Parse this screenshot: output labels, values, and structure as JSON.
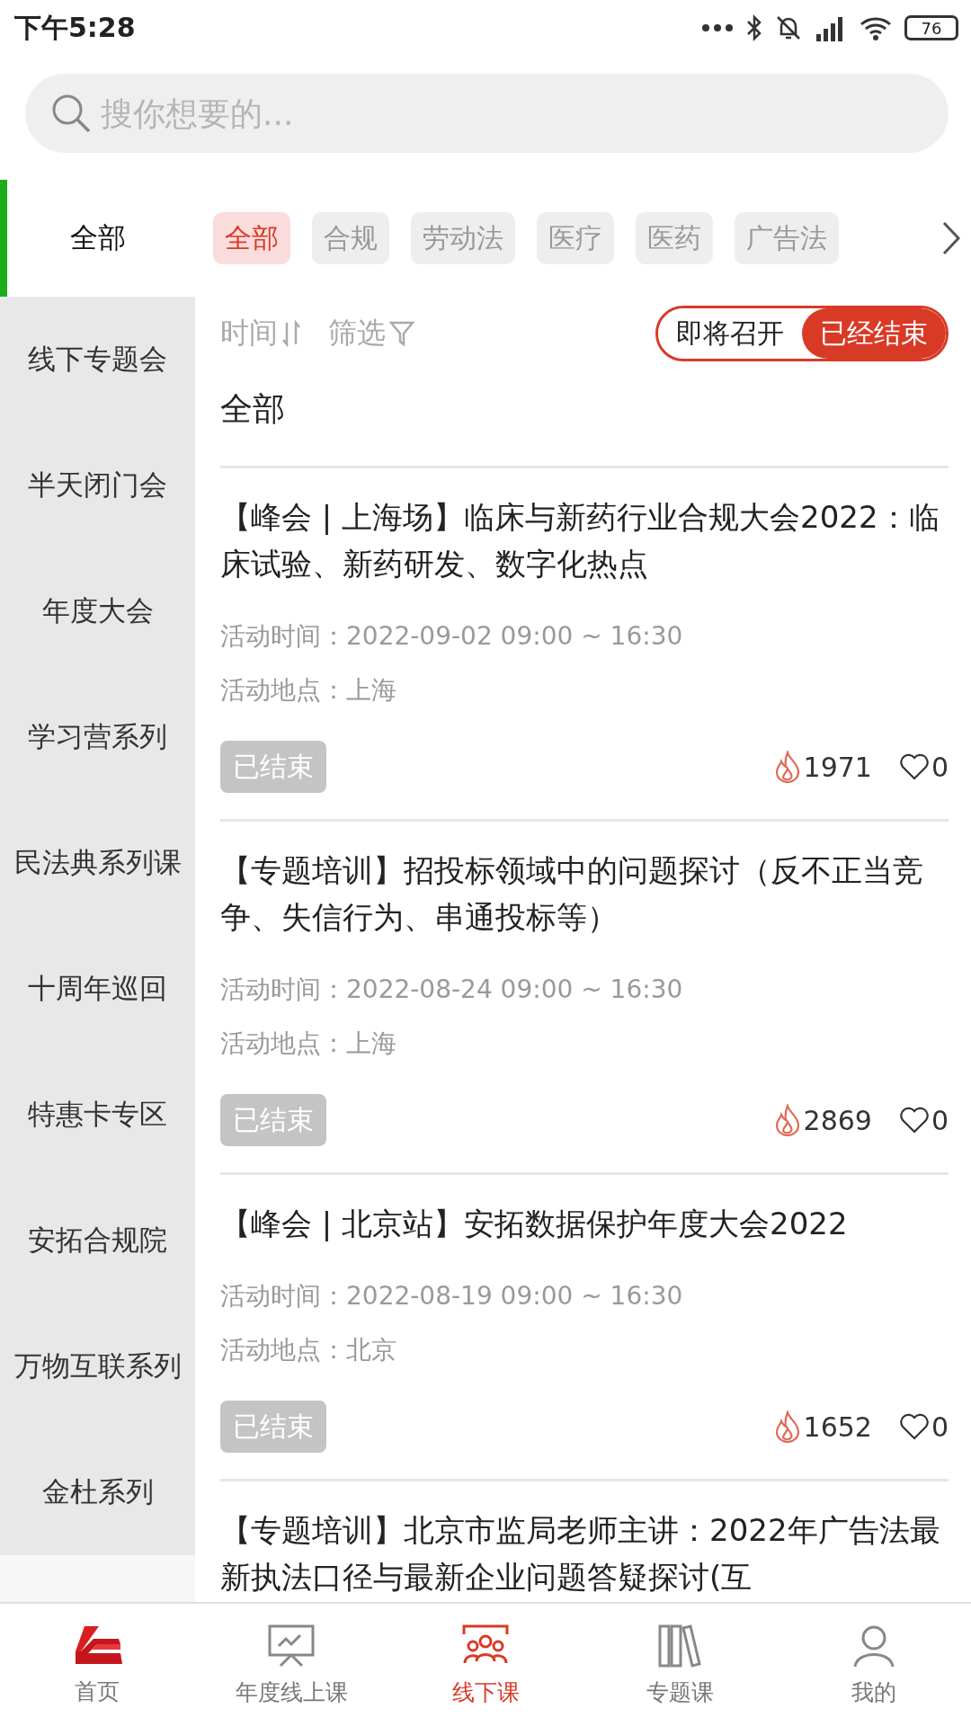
{
  "status_bar": {
    "time": "下午5:28",
    "battery": "76"
  },
  "search": {
    "placeholder": "搜你想要的..."
  },
  "sidebar": {
    "items": [
      {
        "label": "全部",
        "selected": true
      },
      {
        "label": "线下专题会",
        "selected": false
      },
      {
        "label": "半天闭门会",
        "selected": false
      },
      {
        "label": "年度大会",
        "selected": false
      },
      {
        "label": "学习营系列",
        "selected": false
      },
      {
        "label": "民法典系列课",
        "selected": false
      },
      {
        "label": "十周年巡回",
        "selected": false
      },
      {
        "label": "特惠卡专区",
        "selected": false
      },
      {
        "label": "安拓合规院",
        "selected": false
      },
      {
        "label": "万物互联系列",
        "selected": false
      },
      {
        "label": "金杜系列",
        "selected": false
      }
    ]
  },
  "chips": [
    {
      "label": "全部",
      "selected": true
    },
    {
      "label": "合规",
      "selected": false
    },
    {
      "label": "劳动法",
      "selected": false
    },
    {
      "label": "医疗",
      "selected": false
    },
    {
      "label": "医药",
      "selected": false
    },
    {
      "label": "广告法",
      "selected": false
    }
  ],
  "sort": {
    "time_label": "时间",
    "filter_label": "筛选"
  },
  "toggle": [
    {
      "label": "即将召开",
      "selected": false
    },
    {
      "label": "已经结束",
      "selected": true
    }
  ],
  "section_title": "全部",
  "events": [
    {
      "title": "【峰会 | 上海场】临床与新药行业合规大会2022：临床试验、新药研发、数字化热点",
      "time_label": "活动时间：",
      "time": "2022-09-02 09:00 ~ 16:30",
      "place_label": "活动地点：",
      "place": "上海",
      "status": "已结束",
      "views": "1971",
      "likes": "0"
    },
    {
      "title": "【专题培训】招投标领域中的问题探讨（反不正当竞争、失信行为、串通投标等）",
      "time_label": "活动时间：",
      "time": "2022-08-24 09:00 ~ 16:30",
      "place_label": "活动地点：",
      "place": "上海",
      "status": "已结束",
      "views": "2869",
      "likes": "0"
    },
    {
      "title": "【峰会 | 北京站】安拓数据保护年度大会2022",
      "time_label": "活动时间：",
      "time": "2022-08-19 09:00 ~ 16:30",
      "place_label": "活动地点：",
      "place": "北京",
      "status": "已结束",
      "views": "1652",
      "likes": "0"
    },
    {
      "title": "【专题培训】北京市监局老师主讲：2022年广告法最新执法口径与最新企业问题答疑探讨(互"
    }
  ],
  "tabs": [
    {
      "kind": "home",
      "label": "首页",
      "selected": false
    },
    {
      "kind": "screen",
      "label": "年度线上课",
      "selected": false
    },
    {
      "kind": "group",
      "label": "线下课",
      "selected": true
    },
    {
      "kind": "books",
      "label": "专题课",
      "selected": false
    },
    {
      "kind": "person",
      "label": "我的",
      "selected": false
    }
  ]
}
